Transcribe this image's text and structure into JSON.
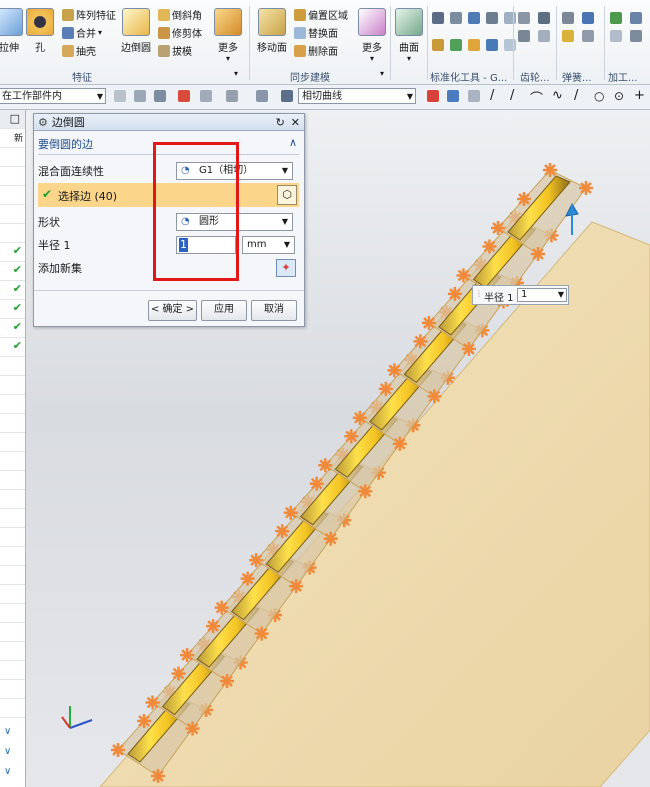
{
  "ribbon": {
    "left_partial_label": "拉伸",
    "hole_label": "孔",
    "array_feature": "阵列特征",
    "merge": "合并",
    "shell": "抽壳",
    "edge_blend": "边倒圆",
    "chamfer": "倒斜角",
    "trim_body": "修剪体",
    "draft": "拔模",
    "more1": "更多",
    "feature_group": "特征",
    "move_face": "移动面",
    "offset_region": "偏置区域",
    "replace_face": "替换面",
    "delete_face": "删除面",
    "more2": "更多",
    "sync_group": "同步建模",
    "surface": "曲面",
    "std_tools_group": "标准化工具 - G...",
    "gear_group": "齿轮...",
    "spring_group": "弹簧...",
    "machining_group": "加工..."
  },
  "toolbar2": {
    "scope": "在工作部件内",
    "curve_rule": "相切曲线"
  },
  "left_panel": {
    "header_partial": "新",
    "checks": [
      "✔",
      "✔",
      "✔",
      "✔",
      "✔",
      "✔"
    ]
  },
  "dialog": {
    "title": "边倒圆",
    "section": "要倒圆的边",
    "continuity_label": "混合面连续性",
    "continuity_value": "G1（相切）",
    "select_edge": "选择边 (40)",
    "shape_label": "形状",
    "shape_value": "圆形",
    "radius_label": "半径 1",
    "radius_value": "1",
    "unit": "mm",
    "add_new_set": "添加新集",
    "ok": "< 确定 >",
    "apply": "应用",
    "cancel": "取消"
  },
  "float_input": {
    "label": "半径 1",
    "value": "1"
  }
}
